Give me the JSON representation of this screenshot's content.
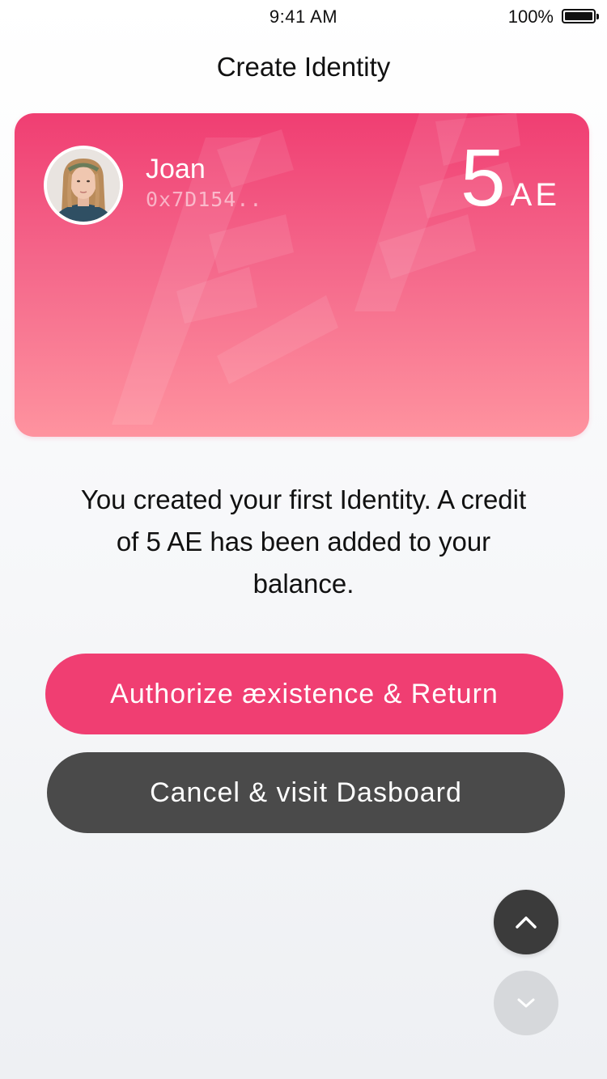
{
  "status_bar": {
    "time": "9:41 AM",
    "battery_percent": "100%",
    "battery_level": 1.0
  },
  "header": {
    "title": "Create Identity"
  },
  "card": {
    "name": "Joan",
    "address": "0x7D154..",
    "balance_amount": "5",
    "balance_unit": "AE",
    "watermark": "ÆÆ",
    "gradient_top": "#f03e72",
    "gradient_bottom": "#fe939f"
  },
  "message": {
    "text": "You created your first Identity. A credit of 5 AE has been added to your balance."
  },
  "buttons": {
    "primary_label": "Authorize æxistence & Return",
    "secondary_label": "Cancel & visit Dasboard",
    "scroll_up_icon": "chevron-up-icon",
    "scroll_down_icon": "chevron-down-icon"
  },
  "colors": {
    "accent": "#f03e72",
    "dark_button": "#4a4a4a",
    "round_up": "#3b3b3b",
    "round_down": "#d6d8db"
  }
}
